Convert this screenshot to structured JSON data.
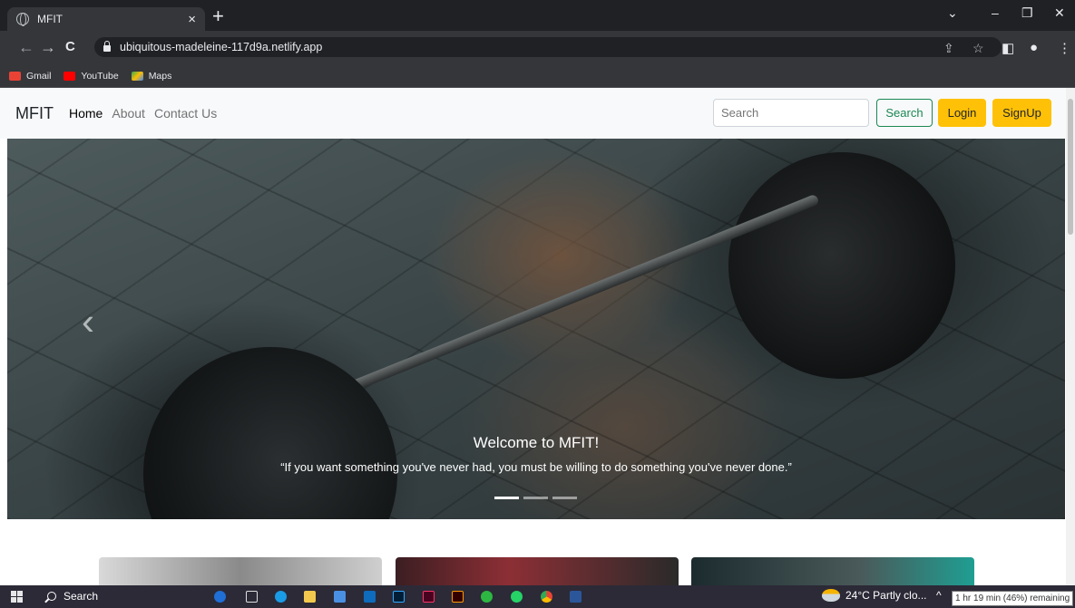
{
  "browser": {
    "tab_title": "MFIT",
    "tab_close": "×",
    "new_tab": "+",
    "window_controls": [
      "⌄",
      "–",
      "❐",
      "✕"
    ],
    "nav": {
      "back": "←",
      "forward": "→",
      "reload": "C"
    },
    "url": "ubiquitous-madeleine-117d9a.netlify.app",
    "bookmarks": [
      {
        "label": "Gmail",
        "color": "#ea4335"
      },
      {
        "label": "YouTube",
        "color": "#ff0000"
      },
      {
        "label": "Maps",
        "color": "#34a853"
      }
    ]
  },
  "site": {
    "brand": "MFIT",
    "nav_links": [
      "Home",
      "About",
      "Contact Us"
    ],
    "search_placeholder": "Search",
    "search_button": "Search",
    "login_button": "Login",
    "signup_button": "SignUp",
    "carousel": {
      "prev": "‹",
      "title": "Welcome to MFIT!",
      "text": "“If you want something you've never had, you must be willing to do something you've never done.”",
      "slides": 3,
      "active_slide": 0
    }
  },
  "taskbar": {
    "search_label": "Search",
    "weather": "24°C  Partly clo...",
    "tray_arrow": "^",
    "battery_tooltip": "1 hr 19 min (46%) remaining"
  },
  "colors": {
    "accent_green": "#198754",
    "warning_yellow": "#ffc107"
  }
}
